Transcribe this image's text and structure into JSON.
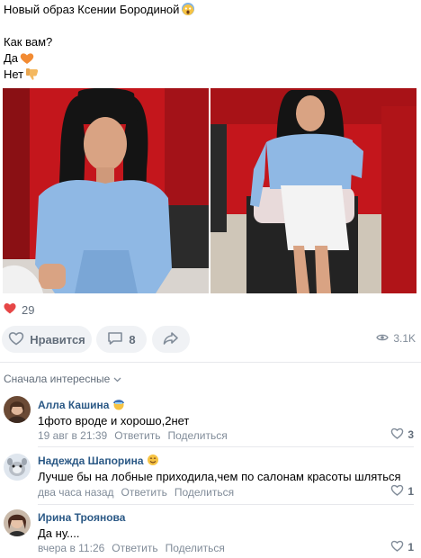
{
  "post": {
    "line1": "Новый образ Ксении Бородиной",
    "line2": "Как вам?",
    "line3": "Да",
    "line4": "Нет"
  },
  "likes": {
    "count": "29"
  },
  "actions": {
    "like_label": "Нравится",
    "comments_count": "8",
    "views": "3.1K"
  },
  "comments_sort": {
    "label": "Сначала интересные"
  },
  "comments": [
    {
      "name": "Алла Кашина",
      "text": "1фото вроде и хорошо,2нет",
      "date": "19 авг в 21:39",
      "reply": "Ответить",
      "share": "Поделиться",
      "likes": "3"
    },
    {
      "name": "Надежда Шапорина",
      "text": "Лучше бы на лобные приходила,чем по салонам красоты шляться",
      "date": "два часа назад",
      "reply": "Ответить",
      "share": "Поделиться",
      "likes": "1"
    },
    {
      "name": "Ирина Троянова",
      "text": "Да ну....",
      "date": "вчера в 11:26",
      "reply": "Ответить",
      "share": "Поделиться",
      "likes": "1"
    }
  ],
  "colors": {
    "link": "#2a5885",
    "like_red": "#e64646",
    "muted": "#818c99",
    "pill_bg": "#f0f2f5"
  }
}
